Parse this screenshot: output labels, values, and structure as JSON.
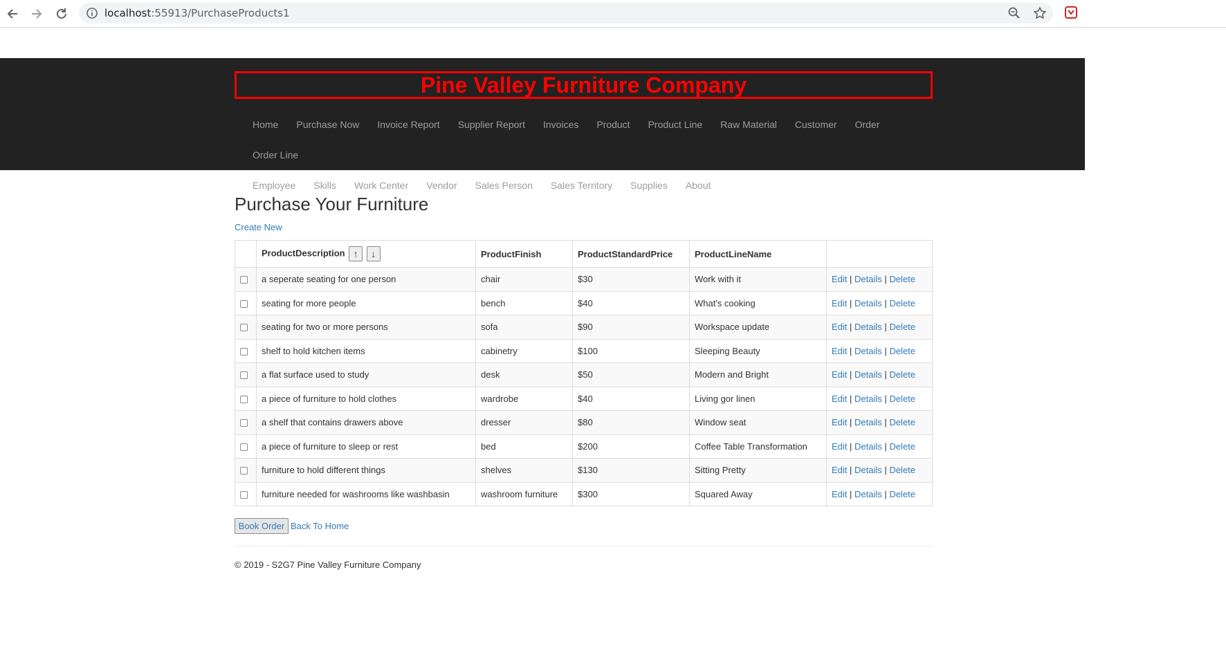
{
  "browser": {
    "url_host": "localhost",
    "url_rest": ":55913/PurchaseProducts1"
  },
  "site": {
    "brand": "Pine Valley Furniture Company",
    "menu_row1": [
      "Home",
      "Purchase Now",
      "Invoice Report",
      "Supplier Report",
      "Invoices",
      "Product",
      "Product Line",
      "Raw Material",
      "Customer",
      "Order",
      "Order Line"
    ],
    "menu_row2": [
      "Employee",
      "Skills",
      "Work Center",
      "Vendor",
      "Sales Person",
      "Sales Territory",
      "Supplies",
      "About"
    ],
    "brand_color": "#ff0000",
    "header_bg": "#222222"
  },
  "main": {
    "title": "Purchase Your Furniture",
    "create_new": "Create New",
    "sort_up": "↑",
    "sort_down": "↓",
    "columns": [
      "ProductDescription",
      "ProductFinish",
      "ProductStandardPrice",
      "ProductLineName"
    ],
    "actions": {
      "edit": "Edit",
      "details": "Details",
      "delete": "Delete",
      "separator": "|"
    },
    "rows": [
      {
        "description": "a seperate seating for one person",
        "finish": "chair",
        "price": "$30",
        "line": "Work with it"
      },
      {
        "description": "seating for more people",
        "finish": "bench",
        "price": "$40",
        "line": "What's cooking"
      },
      {
        "description": "seating for two or more persons",
        "finish": "sofa",
        "price": "$90",
        "line": "Workspace update"
      },
      {
        "description": "shelf to hold kitchen items",
        "finish": "cabinetry",
        "price": "$100",
        "line": "Sleeping Beauty"
      },
      {
        "description": "a flat surface used to study",
        "finish": "desk",
        "price": "$50",
        "line": "Modern and Bright"
      },
      {
        "description": "a piece of furniture to hold clothes",
        "finish": "wardrobe",
        "price": "$40",
        "line": "Living gor linen"
      },
      {
        "description": "a shelf that contains drawers above",
        "finish": "dresser",
        "price": "$80",
        "line": "Window seat"
      },
      {
        "description": "a piece of furniture to sleep or rest",
        "finish": "bed",
        "price": "$200",
        "line": "Coffee Table Transformation"
      },
      {
        "description": "furniture to hold different things",
        "finish": "shelves",
        "price": "$130",
        "line": "Sitting Pretty"
      },
      {
        "description": "furniture needed for washrooms like washbasin",
        "finish": "washroom furniture",
        "price": "$300",
        "line": "Squared Away"
      }
    ],
    "book_order": "Book Order",
    "back_home": "Back To Home",
    "link_color": "#337ab7"
  },
  "footer": {
    "text": "© 2019 - S2G7 Pine Valley Furniture Company"
  },
  "icons": [
    "back-icon",
    "forward-icon",
    "reload-icon",
    "info-icon",
    "zoom-icon",
    "star-icon",
    "extension-icon"
  ]
}
